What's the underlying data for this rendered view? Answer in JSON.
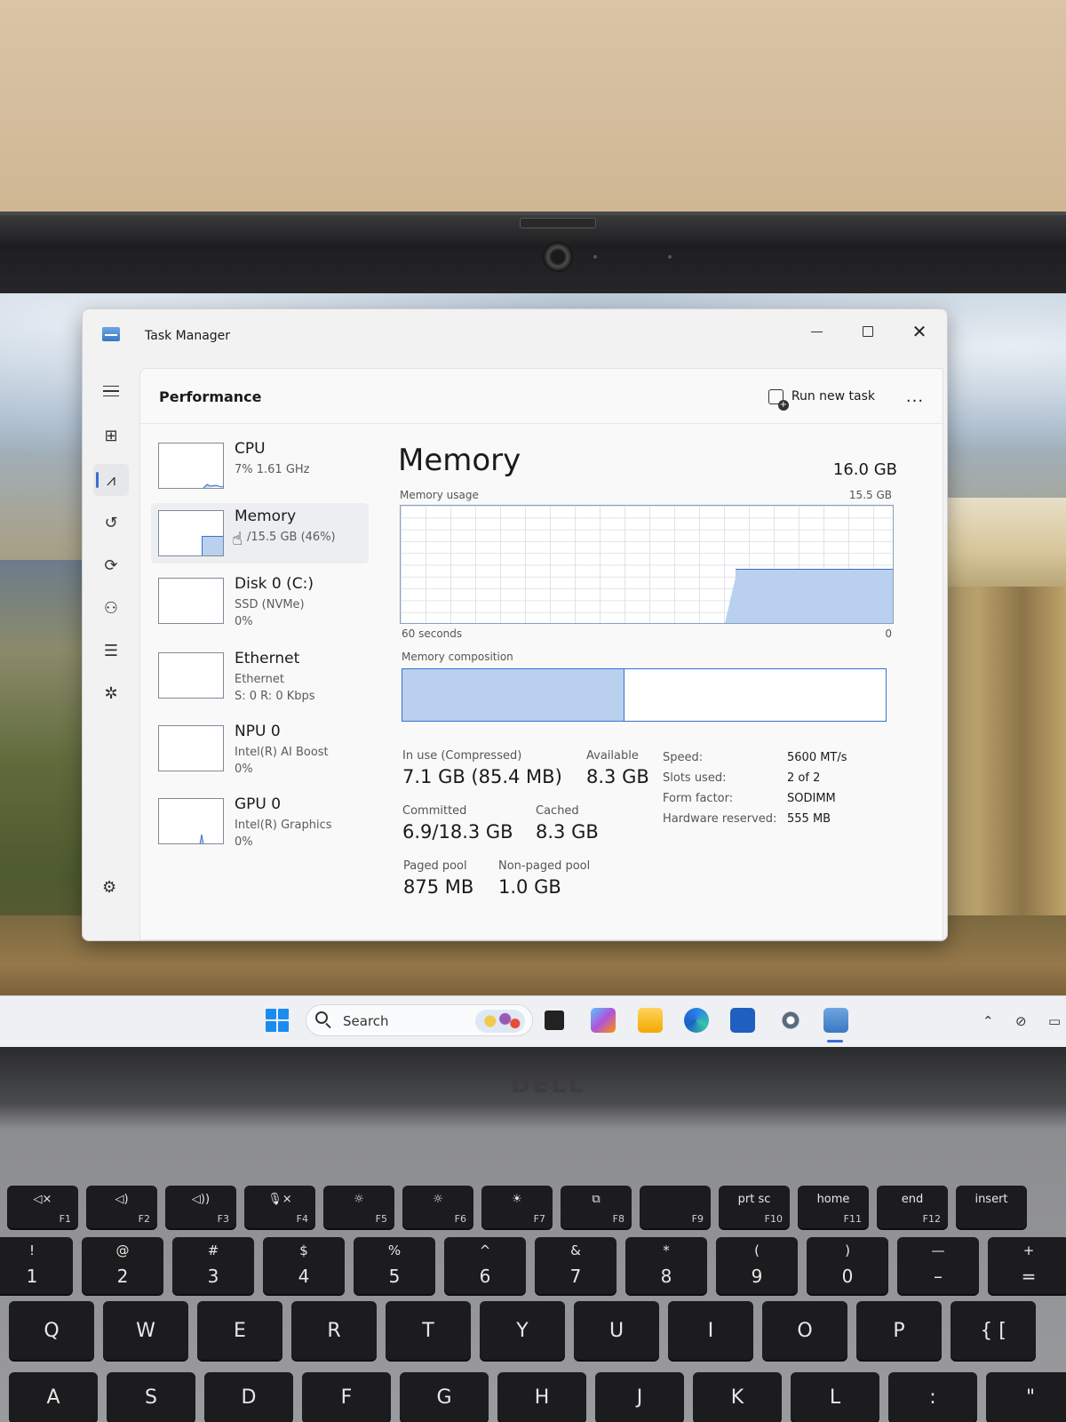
{
  "window": {
    "title": "Task Manager"
  },
  "header": {
    "page_title": "Performance",
    "run_new_task": "Run new task",
    "more": "..."
  },
  "resources": [
    {
      "name": "CPU",
      "sub1": "7%  1.61 GHz",
      "sub2": ""
    },
    {
      "name": "Memory",
      "sub1": "/15.5 GB (46%)",
      "sub2": ""
    },
    {
      "name": "Disk 0 (C:)",
      "sub1": "SSD (NVMe)",
      "sub2": "0%"
    },
    {
      "name": "Ethernet",
      "sub1": "Ethernet",
      "sub2": "S: 0  R: 0 Kbps"
    },
    {
      "name": "NPU 0",
      "sub1": "Intel(R) AI Boost",
      "sub2": "0%"
    },
    {
      "name": "GPU 0",
      "sub1": "Intel(R) Graphics",
      "sub2": "0%"
    }
  ],
  "memory": {
    "title": "Memory",
    "total": "16.0 GB",
    "usage_label": "Memory usage",
    "usage_max": "15.5 GB",
    "time_span": "60 seconds",
    "time_end": "0",
    "usage_level": 0.46,
    "composition_label": "Memory composition",
    "composition_in_use_fraction": 0.46,
    "stats": {
      "in_use_label": "In use (Compressed)",
      "in_use_value": "7.1 GB (85.4 MB)",
      "available_label": "Available",
      "available_value": "8.3 GB",
      "committed_label": "Committed",
      "committed_value": "6.9/18.3 GB",
      "cached_label": "Cached",
      "cached_value": "8.3 GB",
      "paged_label": "Paged pool",
      "paged_value": "875 MB",
      "nonpaged_label": "Non-paged pool",
      "nonpaged_value": "1.0 GB"
    },
    "specs": {
      "speed_label": "Speed:",
      "speed_value": "5600 MT/s",
      "slots_label": "Slots used:",
      "slots_value": "2 of 2",
      "form_label": "Form factor:",
      "form_value": "SODIMM",
      "reserved_label": "Hardware reserved:",
      "reserved_value": "555 MB"
    }
  },
  "taskbar": {
    "search_placeholder": "Search"
  },
  "laptop": {
    "brand": "DELL"
  },
  "keyboard": {
    "fn_row": [
      {
        "label": "◁×",
        "fn": "F1"
      },
      {
        "label": "◁)",
        "fn": "F2"
      },
      {
        "label": "◁))",
        "fn": "F3"
      },
      {
        "label": "🎙×",
        "fn": "F4"
      },
      {
        "label": "☼",
        "fn": "F5"
      },
      {
        "label": "☼",
        "fn": "F6"
      },
      {
        "label": "☀",
        "fn": "F7"
      },
      {
        "label": "⧉",
        "fn": "F8"
      },
      {
        "label": "",
        "fn": "F9"
      },
      {
        "label": "prt sc",
        "fn": "F10"
      },
      {
        "label": "home",
        "fn": "F11"
      },
      {
        "label": "end",
        "fn": "F12"
      },
      {
        "label": "insert",
        "fn": ""
      }
    ],
    "num_row": [
      {
        "top": "!",
        "bottom": "1"
      },
      {
        "top": "@",
        "bottom": "2"
      },
      {
        "top": "#",
        "bottom": "3"
      },
      {
        "top": "$",
        "bottom": "4"
      },
      {
        "top": "%",
        "bottom": "5"
      },
      {
        "top": "^",
        "bottom": "6"
      },
      {
        "top": "&",
        "bottom": "7"
      },
      {
        "top": "*",
        "bottom": "8"
      },
      {
        "top": "(",
        "bottom": "9"
      },
      {
        "top": ")",
        "bottom": "0"
      },
      {
        "top": "—",
        "bottom": "–"
      },
      {
        "top": "+",
        "bottom": "="
      }
    ],
    "qwerty_row": [
      "Q",
      "W",
      "E",
      "R",
      "T",
      "Y",
      "U",
      "I",
      "O",
      "P",
      "{ ["
    ],
    "asdf_row": [
      "A",
      "S",
      "D",
      "F",
      "G",
      "H",
      "J",
      "K",
      "L",
      ":",
      "\""
    ]
  },
  "colors": {
    "accent": "#3b6fd1",
    "graph_fill": "#b9d1ee",
    "window_bg": "#f2f2f3"
  }
}
